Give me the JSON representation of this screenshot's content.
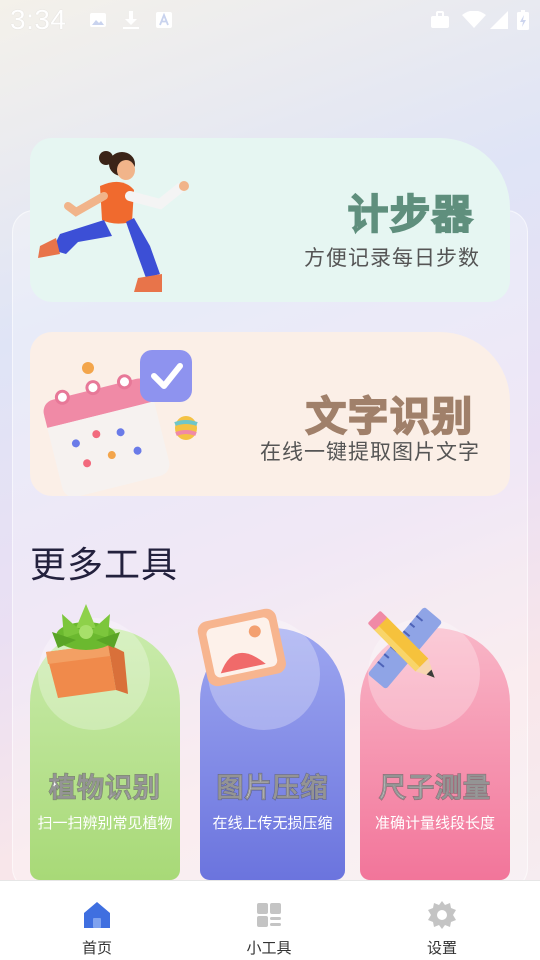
{
  "status_bar": {
    "time": "3:34",
    "left_icons": [
      "image-icon",
      "download-icon",
      "text-a-icon"
    ],
    "right_icons": [
      "briefcase-icon",
      "wifi-icon",
      "signal-icon",
      "battery-charging-icon"
    ]
  },
  "feature_cards": [
    {
      "title": "计步器",
      "subtitle": "方便记录每日步数",
      "icon": "running-woman-illustration"
    },
    {
      "title": "文字识别",
      "subtitle": "在线一键提取图片文字",
      "icon": "calendar-check-illustration"
    }
  ],
  "more_tools": {
    "heading": "更多工具",
    "items": [
      {
        "name": "植物识别",
        "desc": "扫一扫辨别常见植物",
        "icon": "potted-plant-icon",
        "color": "#a8d977"
      },
      {
        "name": "图片压缩",
        "desc": "在线上传无损压缩",
        "icon": "picture-frame-icon",
        "color": "#6b74de"
      },
      {
        "name": "尺子测量",
        "desc": "准确计量线段长度",
        "icon": "pencil-ruler-icon",
        "color": "#f2759a"
      }
    ]
  },
  "bottom_nav": {
    "items": [
      {
        "label": "首页",
        "icon": "home-icon",
        "active": true
      },
      {
        "label": "小工具",
        "icon": "grid-icon",
        "active": false
      },
      {
        "label": "设置",
        "icon": "gear-icon",
        "active": false
      }
    ],
    "active_color": "#3f6fe0",
    "inactive_color": "#c4c4c4"
  }
}
